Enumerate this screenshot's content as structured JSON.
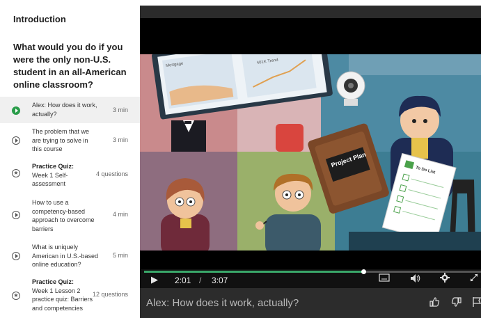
{
  "sidebar": {
    "section_title": "Introduction",
    "lesson_title": "What would you do if you were the only non-U.S. student in an all-American online classroom?",
    "items": [
      {
        "type": "video",
        "active": true,
        "label": "Alex: How does it work, actually?",
        "meta": "3 min"
      },
      {
        "type": "video",
        "active": false,
        "label": "The problem that we are trying to solve in this course",
        "meta": "3 min"
      },
      {
        "type": "quiz",
        "active": false,
        "kind": "Practice Quiz:",
        "label": "Week 1 Self-assessment",
        "meta": "4 questions"
      },
      {
        "type": "video",
        "active": false,
        "label": "How to use a competency-based approach to overcome barriers",
        "meta": "4 min"
      },
      {
        "type": "video",
        "active": false,
        "label": "What is uniquely American in U.S.-based online education?",
        "meta": "5 min"
      },
      {
        "type": "quiz",
        "active": false,
        "kind": "Practice Quiz:",
        "label": "Week 1 Lesson 2 practice quiz: Barriers and competencies",
        "meta": "12 questions"
      }
    ]
  },
  "video": {
    "scene": {
      "monitor_label_1": "Mortgage",
      "monitor_label_2": "401K Trend",
      "folder_title": "Project Plan",
      "todo_title": "To Do List"
    },
    "controls": {
      "current_time": "2:01",
      "separator": "/",
      "duration": "3:07",
      "progress": 0.65
    },
    "caption": "Alex: How does it work, actually?"
  },
  "colors": {
    "accent_green": "#2a9d4a",
    "progress_green": "#3aa86a",
    "player_bg": "#000000"
  }
}
